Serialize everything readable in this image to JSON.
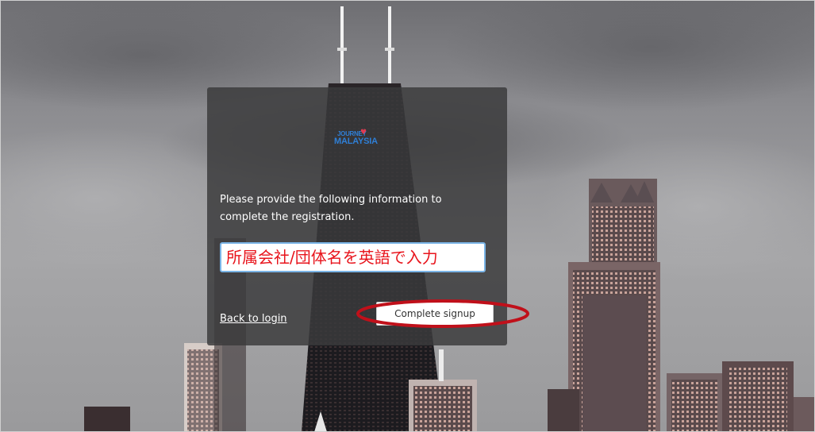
{
  "logo": {
    "top_text": "JOURNEY",
    "bottom_text": "MALAYSIA",
    "heart": "♥"
  },
  "form": {
    "instructions": "Please provide the following information to complete the registration.",
    "org_input_value": "所属会社/団体名を英語で入力",
    "back_link": "Back to login",
    "submit_label": "Complete signup"
  },
  "colors": {
    "card_bg": "#3a3a3c",
    "annotation": "#c0101a",
    "input_text": "#e8141c",
    "logo_blue": "#2f7fd6"
  },
  "icons": {
    "logo": "journey-malaysia-logo"
  }
}
